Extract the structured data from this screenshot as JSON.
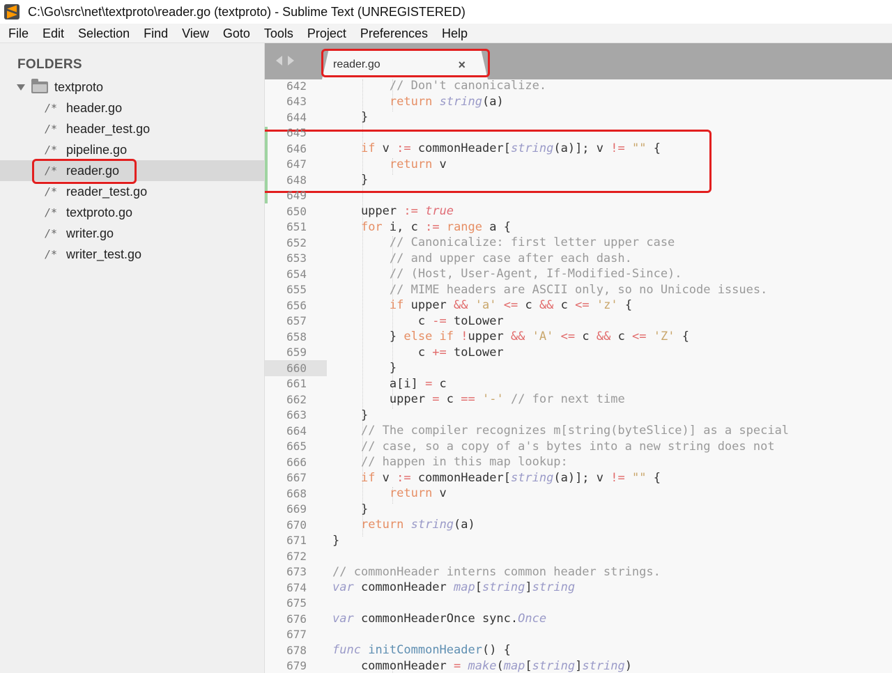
{
  "window": {
    "title": "C:\\Go\\src\\net\\textproto\\reader.go (textproto) - Sublime Text (UNREGISTERED)"
  },
  "menu": [
    "File",
    "Edit",
    "Selection",
    "Find",
    "View",
    "Goto",
    "Tools",
    "Project",
    "Preferences",
    "Help"
  ],
  "sidebar": {
    "title": "FOLDERS",
    "root": "textproto",
    "file_icon": "/*",
    "files": [
      "header.go",
      "header_test.go",
      "pipeline.go",
      "reader.go",
      "reader_test.go",
      "textproto.go",
      "writer.go",
      "writer_test.go"
    ],
    "selected_file": "reader.go"
  },
  "tab": {
    "label": "reader.go",
    "close": "×"
  },
  "editor": {
    "current_line": "660",
    "lines": [
      {
        "n": "642",
        "code": "        <span class='cm'>// Don't canonicalize.</span>"
      },
      {
        "n": "643",
        "code": "        <span class='kw'>return</span> <span class='kw2'>string</span>(a)"
      },
      {
        "n": "644",
        "code": "    }"
      },
      {
        "n": "645",
        "code": ""
      },
      {
        "n": "646",
        "code": "    <span class='kw'>if</span> v <span class='op'>:=</span> commonHeader[<span class='kw2'>string</span>(a)]; v <span class='op'>!=</span> <span class='st'>\"\"</span> {"
      },
      {
        "n": "647",
        "code": "        <span class='kw'>return</span> v"
      },
      {
        "n": "648",
        "code": "    }"
      },
      {
        "n": "649",
        "code": ""
      },
      {
        "n": "650",
        "code": "    upper <span class='op'>:=</span> <span class='bool'>true</span>"
      },
      {
        "n": "651",
        "code": "    <span class='kw'>for</span> i, c <span class='op'>:=</span> <span class='kw'>range</span> a {"
      },
      {
        "n": "652",
        "code": "        <span class='cm'>// Canonicalize: first letter upper case</span>"
      },
      {
        "n": "653",
        "code": "        <span class='cm'>// and upper case after each dash.</span>"
      },
      {
        "n": "654",
        "code": "        <span class='cm'>// (Host, User-Agent, If-Modified-Since).</span>"
      },
      {
        "n": "655",
        "code": "        <span class='cm'>// MIME headers are ASCII only, so no Unicode issues.</span>"
      },
      {
        "n": "656",
        "code": "        <span class='kw'>if</span> upper <span class='op'>&amp;&amp;</span> <span class='st'>'a'</span> <span class='op'>&lt;=</span> c <span class='op'>&amp;&amp;</span> c <span class='op'>&lt;=</span> <span class='st'>'z'</span> {"
      },
      {
        "n": "657",
        "code": "            c <span class='op'>-=</span> toLower"
      },
      {
        "n": "658",
        "code": "        } <span class='kw'>else if</span> <span class='op'>!</span>upper <span class='op'>&amp;&amp;</span> <span class='st'>'A'</span> <span class='op'>&lt;=</span> c <span class='op'>&amp;&amp;</span> c <span class='op'>&lt;=</span> <span class='st'>'Z'</span> {"
      },
      {
        "n": "659",
        "code": "            c <span class='op'>+=</span> toLower"
      },
      {
        "n": "660",
        "code": "        }"
      },
      {
        "n": "661",
        "code": "        a[i] <span class='op'>=</span> c"
      },
      {
        "n": "662",
        "code": "        upper <span class='op'>=</span> c <span class='op'>==</span> <span class='st'>'-'</span> <span class='cm'>// for next time</span>"
      },
      {
        "n": "663",
        "code": "    }"
      },
      {
        "n": "664",
        "code": "    <span class='cm'>// The compiler recognizes m[string(byteSlice)] as a special</span>"
      },
      {
        "n": "665",
        "code": "    <span class='cm'>// case, so a copy of a's bytes into a new string does not</span>"
      },
      {
        "n": "666",
        "code": "    <span class='cm'>// happen in this map lookup:</span>"
      },
      {
        "n": "667",
        "code": "    <span class='kw'>if</span> v <span class='op'>:=</span> commonHeader[<span class='kw2'>string</span>(a)]; v <span class='op'>!=</span> <span class='st'>\"\"</span> {"
      },
      {
        "n": "668",
        "code": "        <span class='kw'>return</span> v"
      },
      {
        "n": "669",
        "code": "    }"
      },
      {
        "n": "670",
        "code": "    <span class='kw'>return</span> <span class='kw2'>string</span>(a)"
      },
      {
        "n": "671",
        "code": "}"
      },
      {
        "n": "672",
        "code": ""
      },
      {
        "n": "673",
        "code": "<span class='cm'>// commonHeader interns common header strings.</span>"
      },
      {
        "n": "674",
        "code": "<span class='kw2'>var</span> commonHeader <span class='kw2'>map</span>[<span class='kw2'>string</span>]<span class='kw2'>string</span>"
      },
      {
        "n": "675",
        "code": ""
      },
      {
        "n": "676",
        "code": "<span class='kw2'>var</span> commonHeaderOnce sync.<span class='kw2'>Once</span>"
      },
      {
        "n": "677",
        "code": ""
      },
      {
        "n": "678",
        "code": "<span class='kw2'>func</span> <span class='fn'>initCommonHeader</span>() {"
      },
      {
        "n": "679",
        "code": "    commonHeader <span class='op'>=</span> <span class='kw2'>make</span>(<span class='kw2'>map</span>[<span class='kw2'>string</span>]<span class='kw2'>string</span>)"
      }
    ]
  },
  "colors": {
    "highlight": "#e21f1f",
    "diff_added": "#9fd4a1"
  }
}
